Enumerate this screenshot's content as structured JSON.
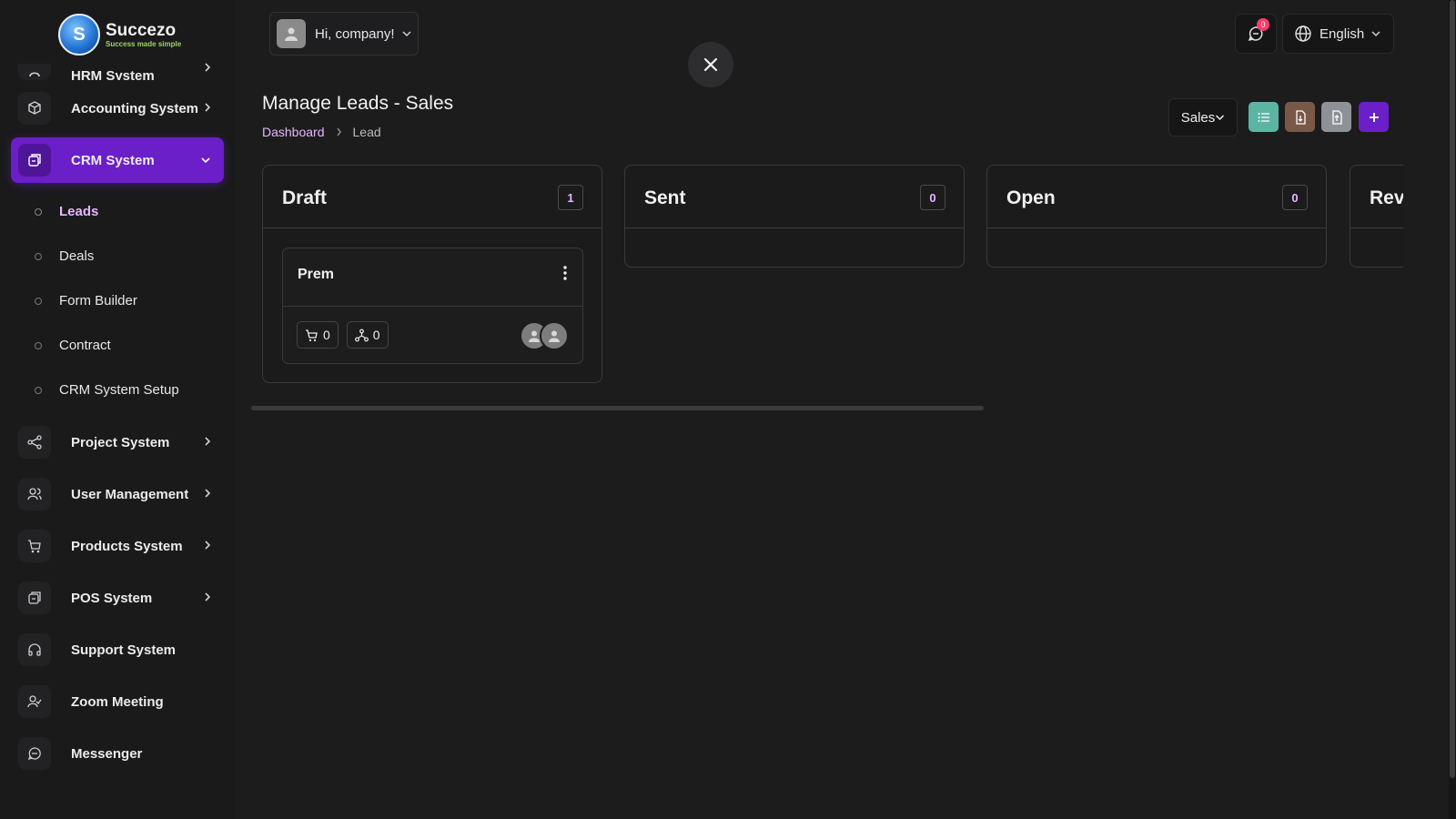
{
  "brand": {
    "name": "Succezo",
    "tagline": "Success made simple",
    "logo_letter": "S"
  },
  "sidebar": {
    "cut_item": {
      "label": "HRM System"
    },
    "items_before": [
      {
        "label": "Accounting System",
        "icon": "box-icon"
      }
    ],
    "active": {
      "label": "CRM System",
      "icon": "crm-icon"
    },
    "submenu": [
      {
        "label": "Leads",
        "current": true
      },
      {
        "label": "Deals"
      },
      {
        "label": "Form Builder"
      },
      {
        "label": "Contract"
      },
      {
        "label": "CRM System Setup"
      }
    ],
    "items_after": [
      {
        "label": "Project System"
      },
      {
        "label": "User Management"
      },
      {
        "label": "Products System"
      },
      {
        "label": "POS System"
      },
      {
        "label": "Support System"
      },
      {
        "label": "Zoom Meeting"
      },
      {
        "label": "Messenger"
      }
    ]
  },
  "topbar": {
    "greeting": "Hi, company!",
    "notification_count": "0",
    "language": "English"
  },
  "header": {
    "title": "Manage Leads - Sales",
    "breadcrumb": {
      "home": "Dashboard",
      "current": "Lead"
    },
    "pipeline": "Sales",
    "action_colors": {
      "list": "#5bb5a2",
      "import": "#7a5848",
      "export": "#8e9196",
      "add": "#6a1fc9"
    }
  },
  "board": {
    "columns": [
      {
        "title": "Draft",
        "count": "1"
      },
      {
        "title": "Sent",
        "count": "0"
      },
      {
        "title": "Open",
        "count": "0"
      },
      {
        "title": "Revi",
        "count": ""
      }
    ],
    "card": {
      "title": "Prem",
      "products": "0",
      "sources": "0"
    }
  }
}
